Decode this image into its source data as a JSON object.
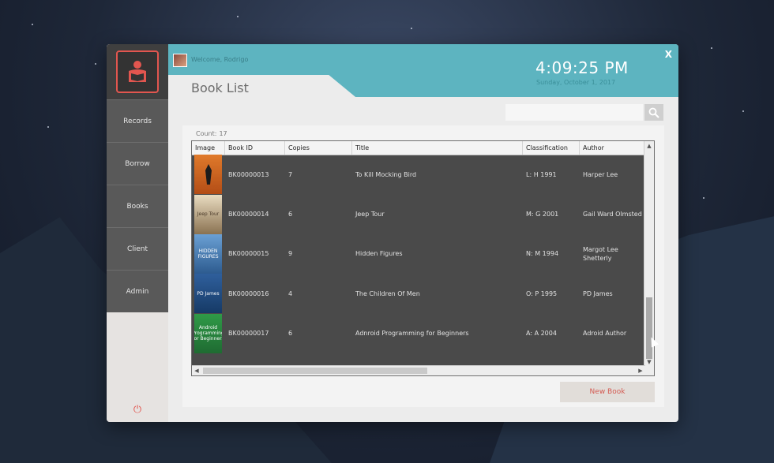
{
  "window": {
    "close_label": "X",
    "welcome": "Welcome, Rodrigo",
    "clock": "4:09:25 PM",
    "date": "Sunday, October 1, 2017",
    "page_title": "Book List"
  },
  "sidebar": {
    "items": [
      {
        "label": "Records"
      },
      {
        "label": "Borrow"
      },
      {
        "label": "Books"
      },
      {
        "label": "Client"
      },
      {
        "label": "Admin"
      }
    ],
    "power_icon": "power-icon"
  },
  "search": {
    "placeholder": "",
    "value": ""
  },
  "list": {
    "count_label": "Count:",
    "count_value": "17",
    "columns": [
      "Image",
      "Book ID",
      "Copies",
      "Title",
      "Classification",
      "Author"
    ],
    "rows": [
      {
        "cover_text": "",
        "book_id": "BK00000013",
        "copies": "7",
        "title": "To Kill Mocking Bird",
        "classification": "L: H 1991",
        "author": "Harper Lee"
      },
      {
        "cover_text": "Jeep Tour",
        "book_id": "BK00000014",
        "copies": "6",
        "title": "Jeep Tour",
        "classification": "M: G 2001",
        "author": "Gail Ward Olmsted"
      },
      {
        "cover_text": "HIDDEN FIGURES",
        "book_id": "BK00000015",
        "copies": "9",
        "title": "Hidden Figures",
        "classification": "N: M 1994",
        "author": "Margot Lee Shetterly"
      },
      {
        "cover_text": "PD James",
        "book_id": "BK00000016",
        "copies": "4",
        "title": "The Children Of Men",
        "classification": "O: P 1995",
        "author": "PD James"
      },
      {
        "cover_text": "Android Programming for Beginners",
        "book_id": "BK00000017",
        "copies": "6",
        "title": "Adnroid Programming for Beginners",
        "classification": "A: A 2004",
        "author": "Adroid Author"
      }
    ]
  },
  "actions": {
    "new_book_label": "New Book"
  },
  "colors": {
    "header": "#5db4c0",
    "accent": "#e2564f",
    "grid_bg": "#4a4a4a",
    "sidebar_item": "#595959"
  }
}
